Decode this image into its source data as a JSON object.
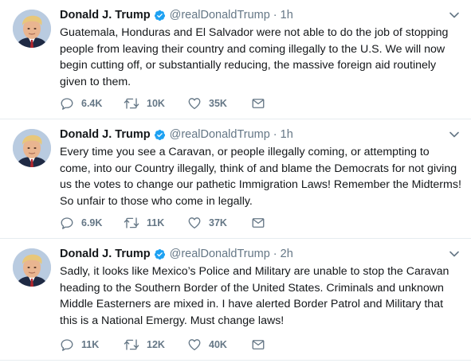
{
  "colors": {
    "verified": "#1da1f2",
    "muted": "#657786",
    "text": "#14171a",
    "border": "#e6ecf0"
  },
  "tweets": [
    {
      "name": "Donald J. Trump",
      "handle": "@realDonaldTrump",
      "separator": "·",
      "time": "1h",
      "text": "Guatemala, Honduras and El Salvador were not able to do the job of stopping people from leaving their country and coming illegally to the U.S. We will now begin cutting off, or substantially reducing, the massive foreign aid routinely given to them.",
      "replies": "6.4K",
      "retweets": "10K",
      "likes": "35K"
    },
    {
      "name": "Donald J. Trump",
      "handle": "@realDonaldTrump",
      "separator": "·",
      "time": "1h",
      "text": "Every time you see a Caravan, or people illegally coming, or attempting to come, into our Country illegally, think of and blame the Democrats for not giving us the votes to change our pathetic Immigration Laws! Remember the Midterms! So unfair to those who come in legally.",
      "replies": "6.9K",
      "retweets": "11K",
      "likes": "37K"
    },
    {
      "name": "Donald J. Trump",
      "handle": "@realDonaldTrump",
      "separator": "·",
      "time": "2h",
      "text": "Sadly, it looks like Mexico’s Police and Military are unable to stop the Caravan heading to the Southern Border of the United States. Criminals and unknown Middle Easterners are mixed in. I have alerted Border Patrol and Military that this is a National Emergy. Must change laws!",
      "replies": "11K",
      "retweets": "12K",
      "likes": "40K"
    }
  ]
}
